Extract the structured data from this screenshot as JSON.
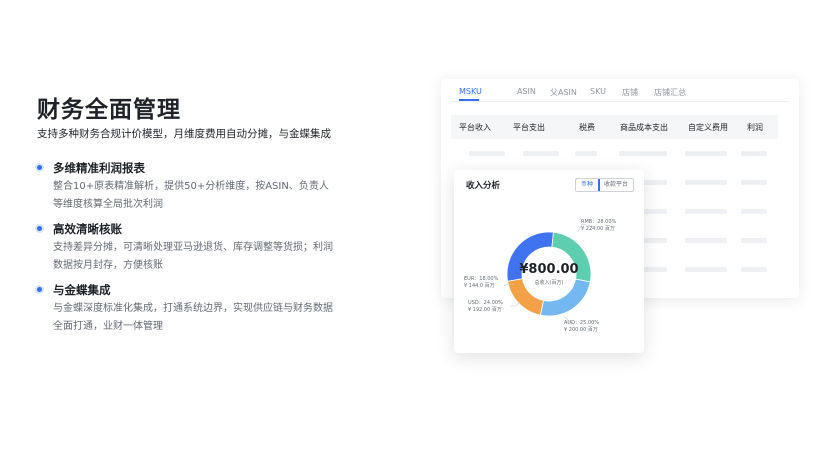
{
  "hero": {
    "title": "财务全面管理",
    "subtitle": "支持多种财务合规计价模型，月维度费用自动分摊，与金蝶集成"
  },
  "features": [
    {
      "title": "多维精准利润报表",
      "desc": "整合10+原表精准解析，提供50+分析维度，按ASIN、负责人等维度核算全局批次利润"
    },
    {
      "title": "高效清晰核账",
      "desc": "支持差异分摊，可清晰处理亚马逊退货、库存调整等货损；利润数据按月封存，方便核账"
    },
    {
      "title": "与金蝶集成",
      "desc": "与金蝶深度标准化集成，打通系统边界，实现供应链与财务数据全面打通，业财一体管理"
    }
  ],
  "report_card": {
    "tabs": [
      "MSKU",
      "ASIN",
      "父ASIN",
      "SKU",
      "店铺",
      "店铺汇总"
    ],
    "active_tab": 0,
    "columns": [
      "平台收入",
      "平台支出",
      "税费",
      "商品成本支出",
      "自定义费用",
      "利润"
    ]
  },
  "income_card": {
    "title": "收入分析",
    "toggle": [
      "币种",
      "收款平台"
    ],
    "center_value": "¥800.00",
    "center_label": "总收入(百万)",
    "colors": {
      "RMB": "#3f73f0",
      "AUD": "#5dcfb0",
      "USD": "#74b8f2",
      "EUR": "#f2a146"
    },
    "labels": {
      "RMB": {
        "l1": "RMB：28.00%",
        "l2": "¥ 224.00 百万"
      },
      "AUD": {
        "l1": "AUD：25.00%",
        "l2": "¥ 200.00 百万"
      },
      "USD": {
        "l1": "USD：24.00%",
        "l2": "¥ 192.00 百万"
      },
      "EUR": {
        "l1": "EUR：18.00%",
        "l2": "¥ 144.0 百万"
      }
    }
  },
  "chart_data": {
    "type": "pie",
    "title": "收入分析",
    "categories": [
      "RMB",
      "AUD",
      "USD",
      "EUR"
    ],
    "values": [
      28.0,
      25.0,
      24.0,
      18.0
    ],
    "amounts": [
      224.0,
      200.0,
      192.0,
      144.0
    ],
    "unit": "百万",
    "total_label": "总收入(百万)",
    "total": 800.0
  }
}
